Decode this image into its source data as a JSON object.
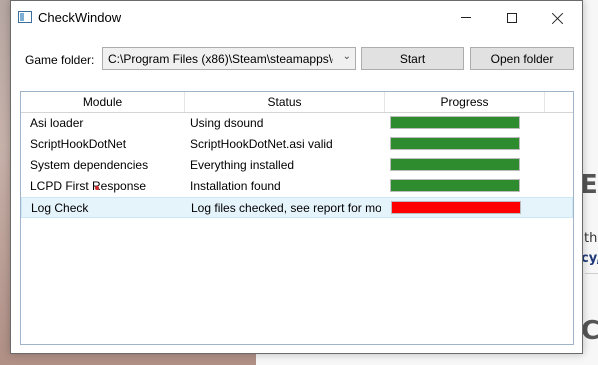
{
  "window": {
    "title": "CheckWindow"
  },
  "toolbar": {
    "folder_label": "Game folder:",
    "folder_value": "C:\\Program Files (x86)\\Steam\\steamapps\\c",
    "start_label": "Start",
    "open_label": "Open folder"
  },
  "grid": {
    "columns": [
      "Module",
      "Status",
      "Progress"
    ],
    "rows": [
      {
        "module": "Asi loader",
        "status": "Using dsound",
        "progress": 1.0,
        "color": "#2e8b2e"
      },
      {
        "module": "ScriptHookDotNet",
        "status": "ScriptHookDotNet.asi valid",
        "progress": 1.0,
        "color": "#2e8b2e"
      },
      {
        "module": "System dependencies",
        "status": "Everything installed",
        "progress": 1.0,
        "color": "#2e8b2e"
      },
      {
        "module": "LCPD First Response",
        "status": "Installation found",
        "progress": 1.0,
        "color": "#2e8b2e"
      },
      {
        "module": "Log Check",
        "status": "Log files checked, see report for mo",
        "progress": 1.0,
        "color": "#ff0000",
        "selected": true
      }
    ]
  },
  "background": {
    "letter_e": "E",
    "text_th": "th",
    "text_cy": "cy,",
    "letter_c": "C"
  },
  "icons": {
    "app": "window-app-icon",
    "minimize": "minimize-icon",
    "maximize": "maximize-icon",
    "close": "close-icon",
    "dropdown": "chevron-down-icon"
  }
}
